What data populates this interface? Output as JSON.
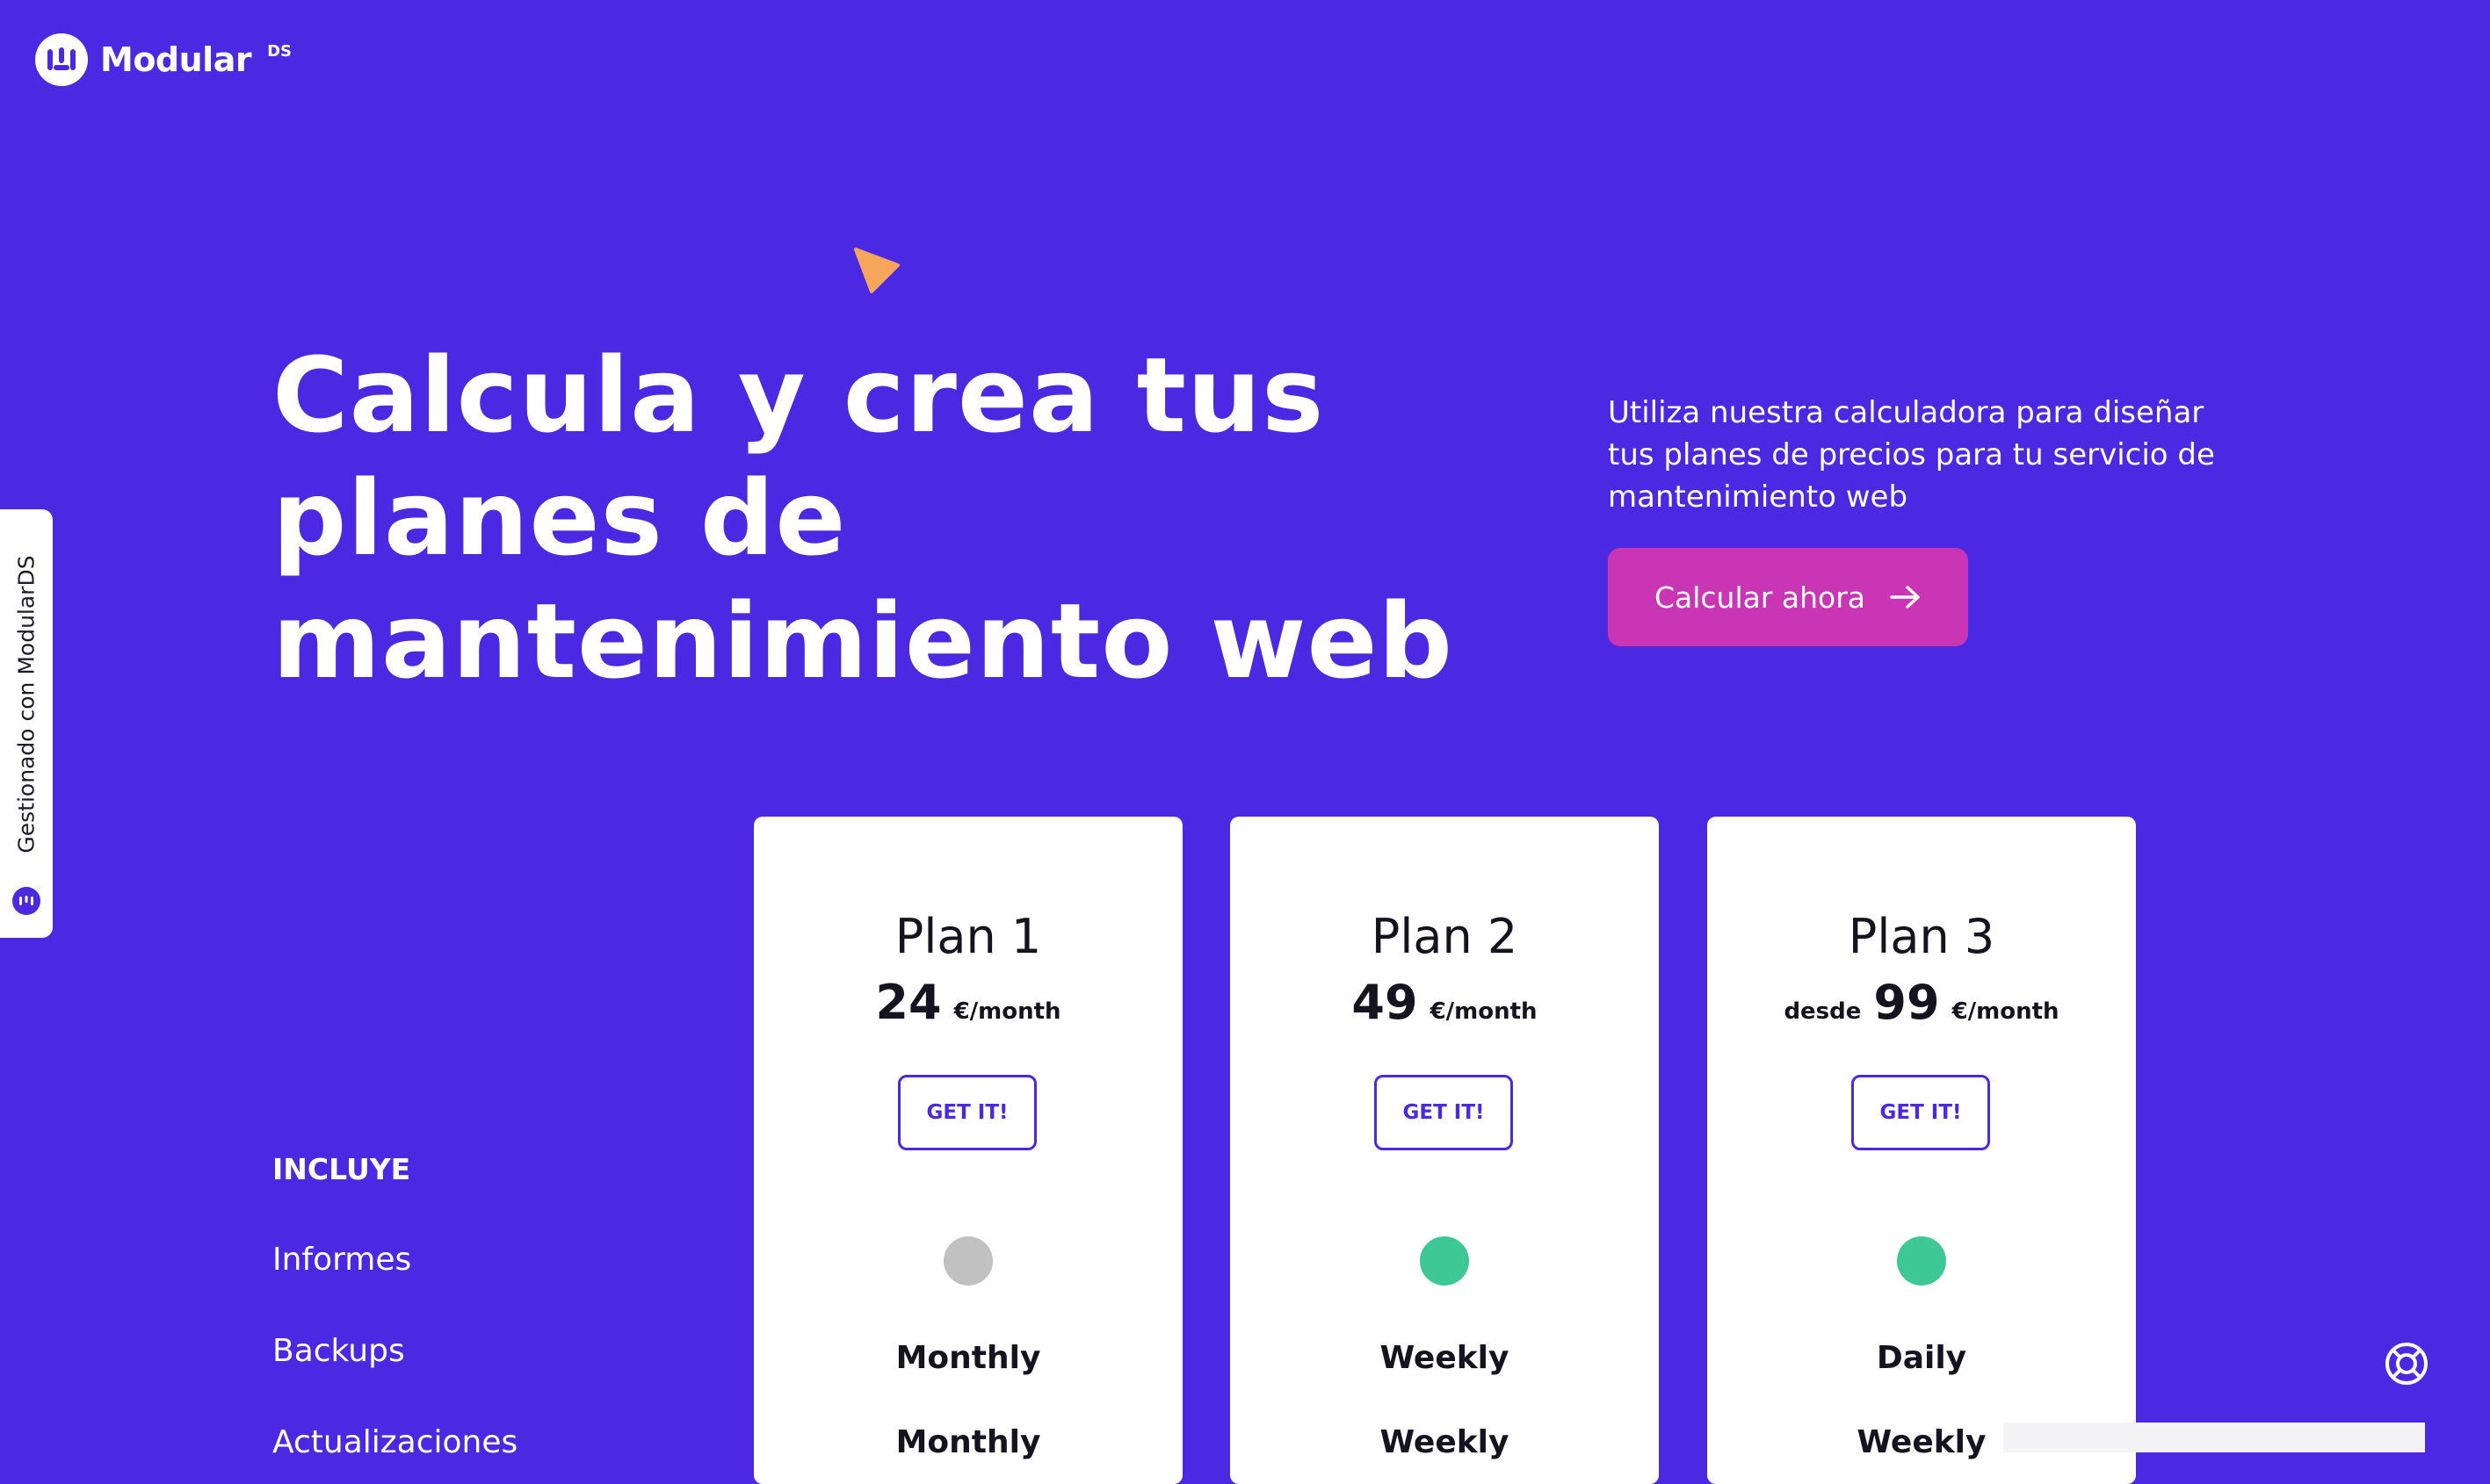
{
  "brand": {
    "name": "Modular",
    "suffix": "DS"
  },
  "hero": {
    "title_lines": [
      "Calcula y crea tus",
      "planes de",
      "mantenimiento web"
    ],
    "description_lines": [
      "Utiliza nuestra calculadora para diseñar",
      "tus planes de precios para tu servicio de",
      "mantenimiento web"
    ],
    "cta_label": "Calcular ahora"
  },
  "side_tab": {
    "label": "Gestionado con ModularDS"
  },
  "includes": {
    "heading": "INCLUYE",
    "features": [
      "Informes",
      "Backups",
      "Actualizaciones"
    ]
  },
  "plans": [
    {
      "name": "Plan 1",
      "prefix": "",
      "price": "24",
      "unit": "€/month",
      "button": "GET IT!",
      "dot_color": "#c1c1c1",
      "informes": "Monthly",
      "backups": "Monthly"
    },
    {
      "name": "Plan 2",
      "prefix": "",
      "price": "49",
      "unit": "€/month",
      "button": "GET IT!",
      "dot_color": "#3ec896",
      "informes": "Weekly",
      "backups": "Weekly"
    },
    {
      "name": "Plan 3",
      "prefix": "desde",
      "price": "99",
      "unit": "€/month",
      "button": "GET IT!",
      "dot_color": "#3ec896",
      "informes": "Daily",
      "backups": "Weekly"
    }
  ],
  "icons": {
    "logo": "modular-logo-icon",
    "cta_arrow": "arrow-right-icon",
    "triangle": "triangle-decoration-icon",
    "help": "lifebuoy-icon"
  },
  "colors": {
    "background": "#4b28e2",
    "cta": "#c935b4",
    "accent_triangle": "#f5a65b",
    "dot_inactive": "#c1c1c1",
    "dot_active": "#3ec896"
  }
}
